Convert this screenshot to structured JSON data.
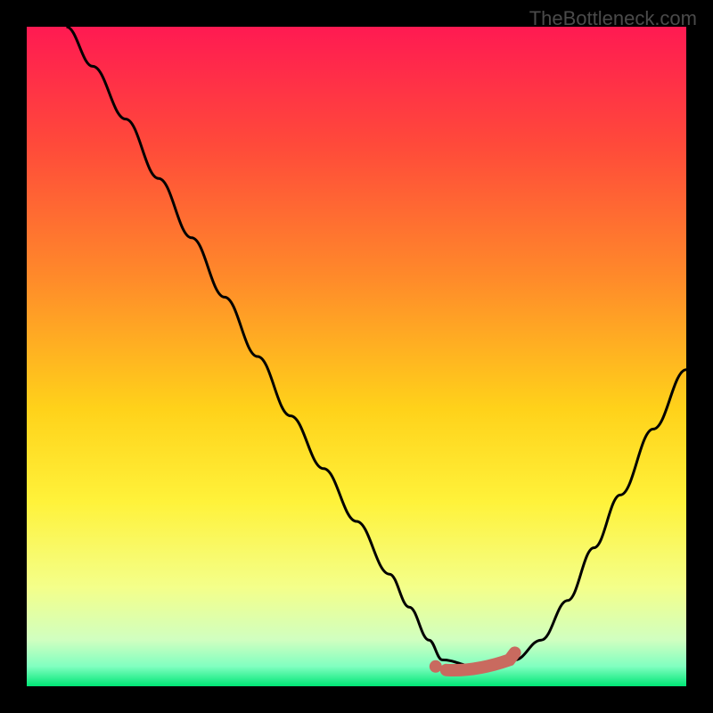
{
  "watermark": "TheBottleneck.com",
  "chart_data": {
    "type": "line",
    "title": "",
    "xlabel": "",
    "ylabel": "",
    "xlim": [
      0,
      100
    ],
    "ylim": [
      0,
      100
    ],
    "background_gradient": {
      "top": "#ff1a52",
      "mid_upper": "#ff8a2a",
      "mid": "#ffe31a",
      "mid_lower": "#f9ff66",
      "near_bottom": "#d9ffb3",
      "bottom": "#00e676"
    },
    "series": [
      {
        "name": "curve",
        "x": [
          6,
          10,
          15,
          20,
          25,
          30,
          35,
          40,
          45,
          50,
          55,
          58,
          61,
          63,
          68,
          72,
          74,
          78,
          82,
          86,
          90,
          95,
          100
        ],
        "y": [
          100,
          94,
          86,
          77,
          68,
          59,
          50,
          41,
          33,
          25,
          17,
          12,
          7,
          4,
          3,
          3,
          4,
          7,
          13,
          21,
          29,
          39,
          48
        ]
      },
      {
        "name": "highlight-band",
        "x": [
          62,
          74
        ],
        "y": [
          3,
          4
        ]
      }
    ],
    "highlight_color": "#c96a5f",
    "curve_color": "#000000"
  }
}
